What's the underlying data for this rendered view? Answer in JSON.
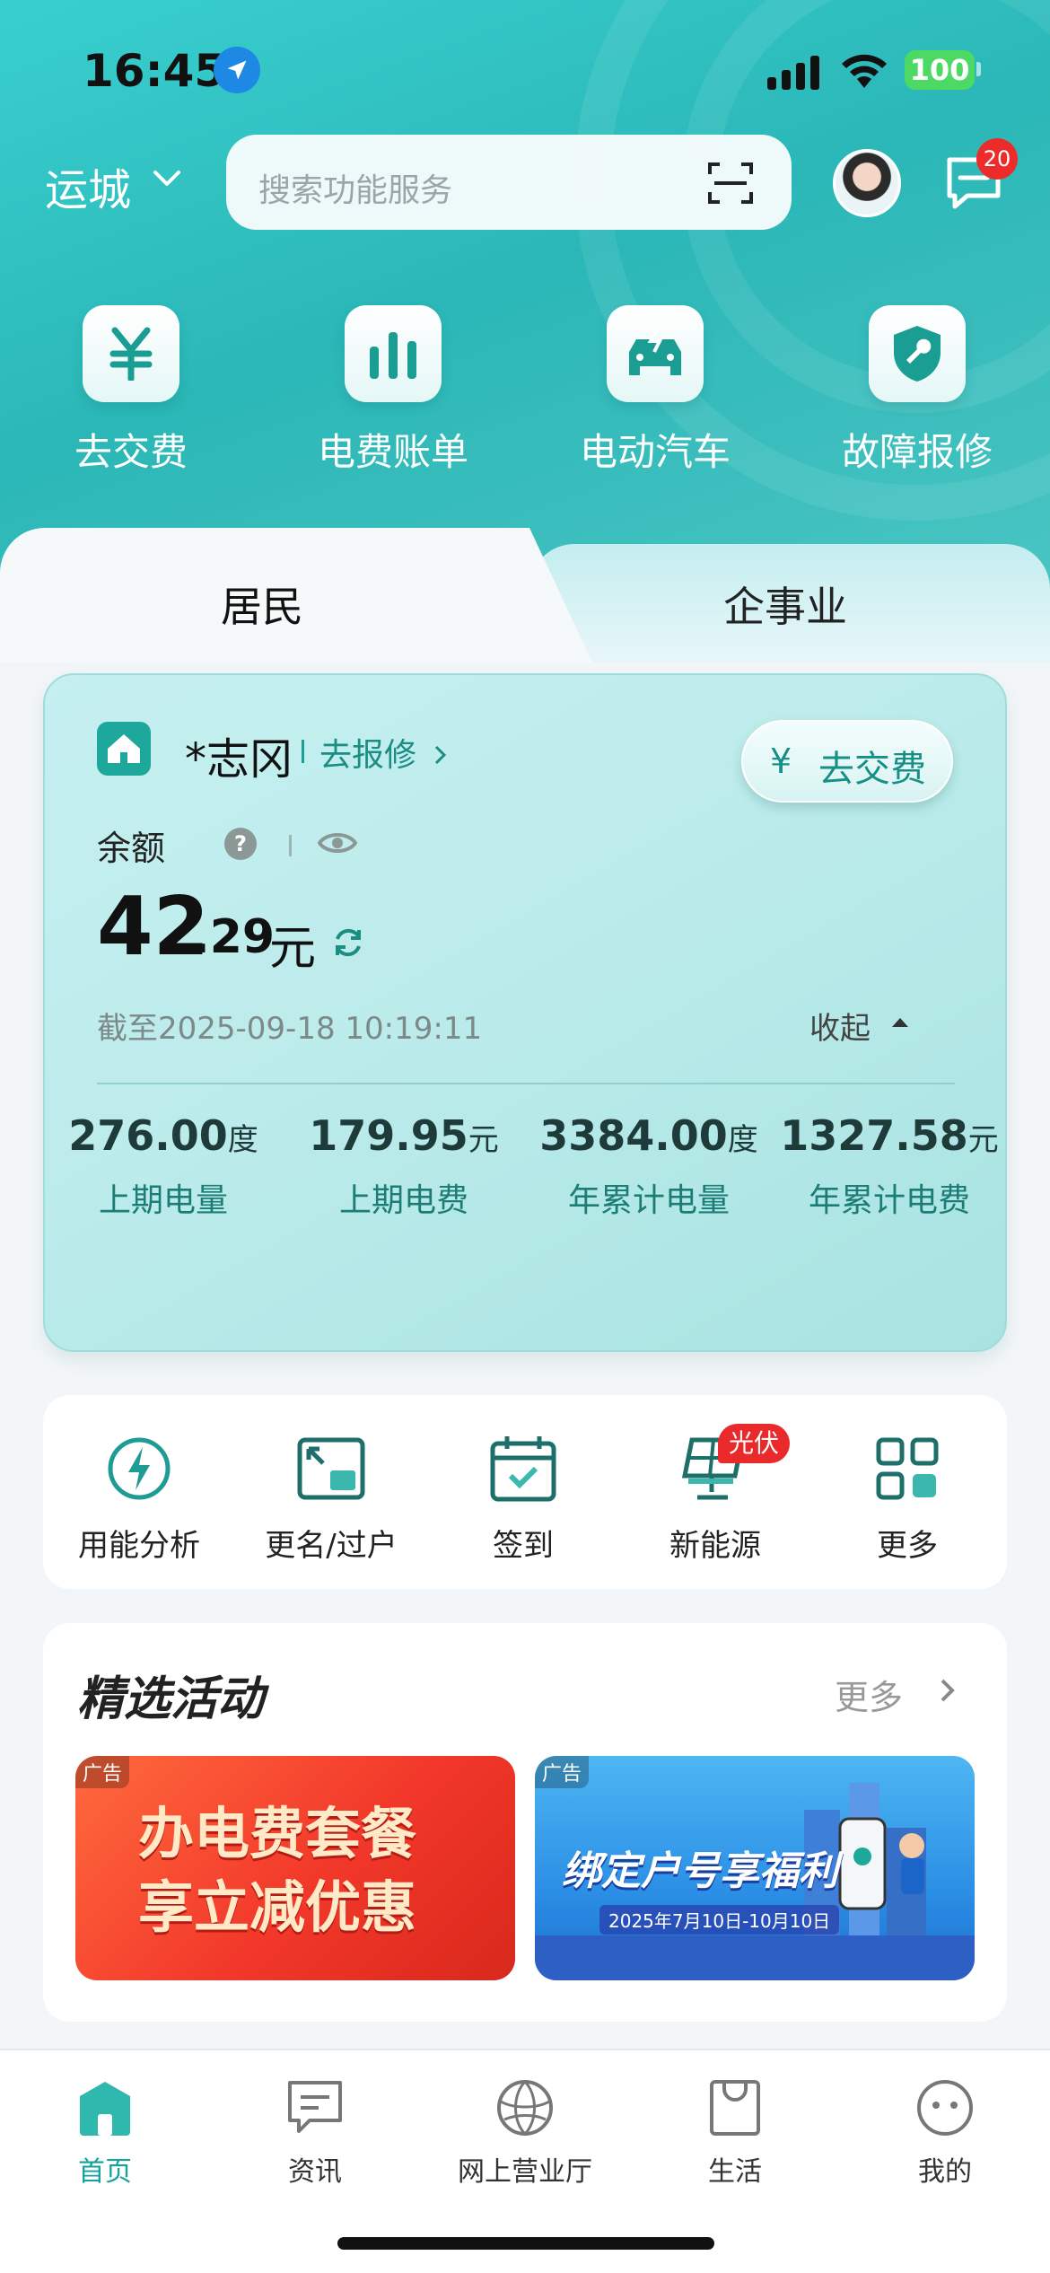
{
  "status_bar": {
    "time": "16:45",
    "battery": "100"
  },
  "header": {
    "city": "运城",
    "search_placeholder": "搜索功能服务",
    "message_badge": "20"
  },
  "quick_actions": [
    {
      "label": "去交费",
      "icon": "yuan-icon"
    },
    {
      "label": "电费账单",
      "icon": "bar-chart-icon"
    },
    {
      "label": "电动汽车",
      "icon": "ev-car-icon"
    },
    {
      "label": "故障报修",
      "icon": "wrench-shield-icon"
    }
  ],
  "account_tabs": {
    "active": "居民",
    "inactive": "企事业"
  },
  "account_card": {
    "name": "*志冈",
    "repair_link": "去报修",
    "pay_button_symbol": "¥",
    "pay_button": "去交费",
    "balance_label": "余额",
    "balance_integer": "42",
    "balance_decimal": ".29",
    "balance_unit": "元",
    "as_of": "截至2025-09-18 10:19:11",
    "collapse": "收起",
    "stats": [
      {
        "value": "276.00",
        "unit": "度",
        "label": "上期电量"
      },
      {
        "value": "179.95",
        "unit": "元",
        "label": "上期电费"
      },
      {
        "value": "3384.00",
        "unit": "度",
        "label": "年累计电量"
      },
      {
        "value": "1327.58",
        "unit": "元",
        "label": "年累计电费"
      }
    ]
  },
  "services": [
    {
      "label": "用能分析",
      "icon": "energy-analysis-icon"
    },
    {
      "label": "更名/过户",
      "icon": "transfer-icon"
    },
    {
      "label": "签到",
      "icon": "calendar-check-icon"
    },
    {
      "label": "新能源",
      "icon": "solar-panel-icon",
      "badge": "光伏"
    },
    {
      "label": "更多",
      "icon": "grid-icon"
    }
  ],
  "activities": {
    "title": "精选活动",
    "more": "更多",
    "banners": [
      {
        "tag": "广告",
        "line1": "办电费套餐",
        "line2": "享立减优惠"
      },
      {
        "tag": "广告",
        "title": "绑定户号享福利",
        "subtitle": "2025年7月10日-10月10日"
      }
    ]
  },
  "tab_bar": [
    {
      "label": "首页",
      "icon": "home-icon",
      "active": true
    },
    {
      "label": "资讯",
      "icon": "news-icon",
      "active": false
    },
    {
      "label": "网上营业厅",
      "icon": "globe-icon",
      "active": false
    },
    {
      "label": "生活",
      "icon": "shopping-bag-icon",
      "active": false
    },
    {
      "label": "我的",
      "icon": "profile-face-icon",
      "active": false
    }
  ],
  "colors": {
    "brand": "#13a39a",
    "header": "#2bb7b7",
    "badge_red": "#ee2b2b"
  }
}
